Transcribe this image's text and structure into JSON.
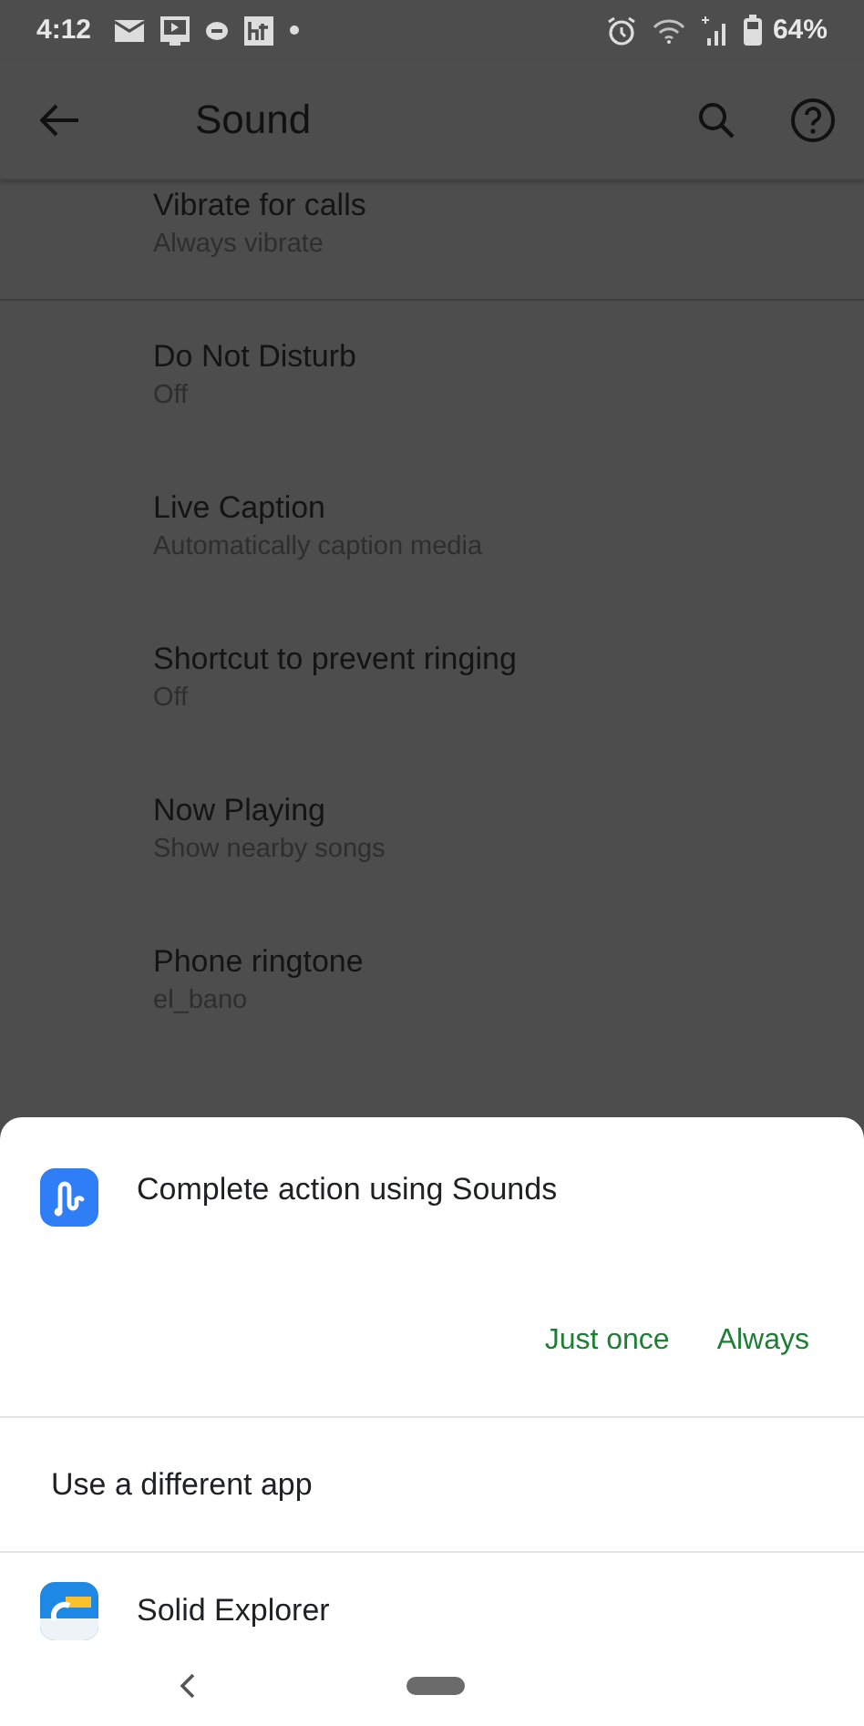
{
  "status_bar": {
    "time": "4:12",
    "battery": "64%"
  },
  "toolbar": {
    "title": "Sound"
  },
  "sections": [
    {
      "items": [
        {
          "title": "Vibrate for calls",
          "summary": "Always vibrate"
        }
      ]
    },
    {
      "items": [
        {
          "title": "Do Not Disturb",
          "summary": "Off"
        },
        {
          "title": "Live Caption",
          "summary": "Automatically caption media"
        },
        {
          "title": "Shortcut to prevent ringing",
          "summary": "Off"
        },
        {
          "title": "Now Playing",
          "summary": "Show nearby songs"
        },
        {
          "title": "Phone ringtone",
          "summary": "el_bano"
        }
      ]
    }
  ],
  "sheet": {
    "title": "Complete action using Sounds",
    "buttons": [
      "Just once",
      "Always"
    ],
    "other_option": "Use a different app",
    "apps": [
      {
        "name": "Solid Explorer"
      }
    ]
  }
}
